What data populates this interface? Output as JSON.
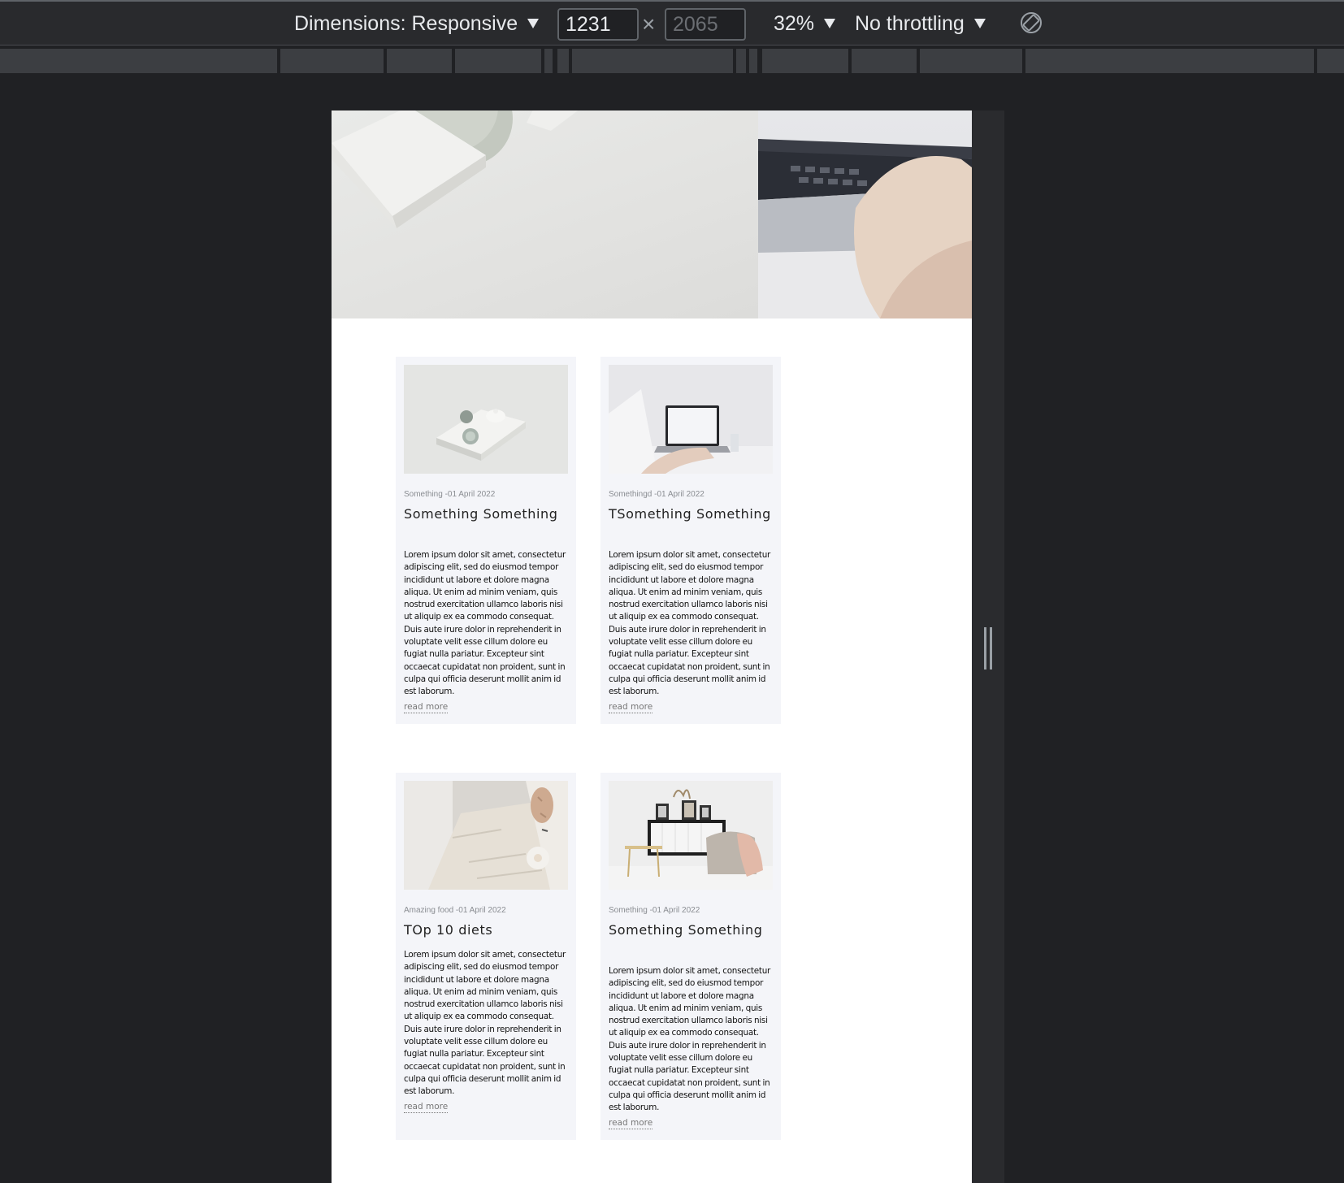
{
  "toolbar": {
    "dimensions_label": "Dimensions: Responsive",
    "width_value": "1231",
    "height_placeholder": "2065",
    "times_symbol": "×",
    "zoom": "32%",
    "throttling": "No throttling"
  },
  "cards": [
    {
      "meta": "Something -01 April 2022",
      "title": "Something Something",
      "body": "Lorem ipsum dolor sit amet, consectetur adipiscing elit, sed do eiusmod tempor incididunt ut labore et dolore magna aliqua. Ut enim ad minim veniam, quis nostrud exercitation ullamco laboris nisi ut aliquip ex ea commodo consequat. Duis aute irure dolor in reprehenderit in voluptate velit esse cillum dolore eu fugiat nulla pariatur. Excepteur sint occaecat cupidatat non proident, sunt in culpa qui officia deserunt mollit anim id est laborum.",
      "link": "read more"
    },
    {
      "meta": "Somethingd -01 April 2022",
      "title": "TSomething Something",
      "body": "Lorem ipsum dolor sit amet, consectetur adipiscing elit, sed do eiusmod tempor incididunt ut labore et dolore magna aliqua. Ut enim ad minim veniam, quis nostrud exercitation ullamco laboris nisi ut aliquip ex ea commodo consequat. Duis aute irure dolor in reprehenderit in voluptate velit esse cillum dolore eu fugiat nulla pariatur. Excepteur sint occaecat cupidatat non proident, sunt in culpa qui officia deserunt mollit anim id est laborum.",
      "link": "read more"
    },
    {
      "meta": "Amazing food -01 April 2022",
      "title": "TOp 10 diets",
      "body": "Lorem ipsum dolor sit amet, consectetur adipiscing elit, sed do eiusmod tempor incididunt ut labore et dolore magna aliqua. Ut enim ad minim veniam, quis nostrud exercitation ullamco laboris nisi ut aliquip ex ea commodo consequat. Duis aute irure dolor in reprehenderit in voluptate velit esse cillum dolore eu fugiat nulla pariatur. Excepteur sint occaecat cupidatat non proident, sunt in culpa qui officia deserunt mollit anim id est laborum.",
      "link": "read more"
    },
    {
      "meta": "Something -01 April 2022",
      "title": "Something Something",
      "body": "Lorem ipsum dolor sit amet, consectetur adipiscing elit, sed do eiusmod tempor incididunt ut labore et dolore magna aliqua. Ut enim ad minim veniam, quis nostrud exercitation ullamco laboris nisi ut aliquip ex ea commodo consequat. Duis aute irure dolor in reprehenderit in voluptate velit esse cillum dolore eu fugiat nulla pariatur. Excepteur sint occaecat cupidatat non proident, sunt in culpa qui officia deserunt mollit anim id est laborum.",
      "link": "read more"
    }
  ]
}
